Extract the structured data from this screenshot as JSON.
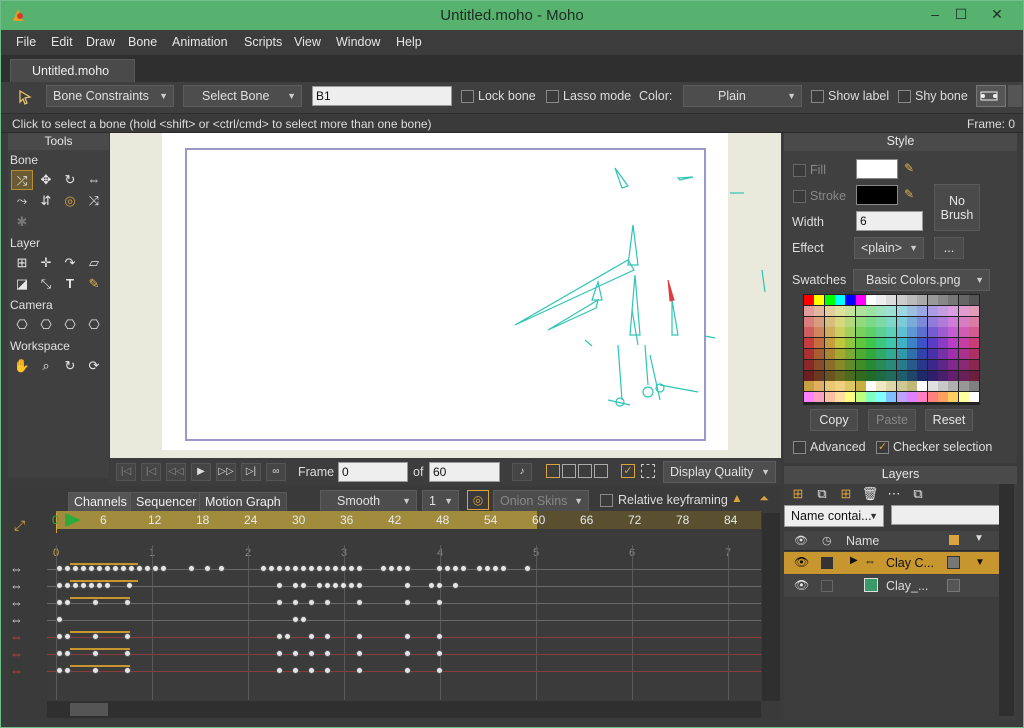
{
  "window": {
    "title": "Untitled.moho - Moho",
    "min": "–",
    "max": "☐",
    "close": "✕"
  },
  "menu": [
    "File",
    "Edit",
    "Draw",
    "Bone",
    "Animation",
    "Scripts",
    "View",
    "Window",
    "Help"
  ],
  "doc_tab": "Untitled.moho",
  "toolbar": {
    "bone_constraints": "Bone Constraints",
    "select_bone": "Select Bone",
    "bone_name": "B1",
    "lock_bone": "Lock bone",
    "lasso_mode": "Lasso mode",
    "color_label": "Color:",
    "color_value": "Plain",
    "show_label": "Show label",
    "shy_bone": "Shy bone"
  },
  "status": {
    "hint": "Click to select a bone (hold <shift> or <ctrl/cmd> to select more than one bone)",
    "frame": "Frame: 0"
  },
  "tools": {
    "title": "Tools",
    "bone": "Bone",
    "layer": "Layer",
    "camera": "Camera",
    "workspace": "Workspace"
  },
  "playback": {
    "frame_label": "Frame",
    "frame_value": "0",
    "of_label": "of",
    "total_value": "60",
    "display_quality": "Display Quality"
  },
  "timeline": {
    "tabs": [
      "Channels",
      "Sequencer",
      "Motion Graph"
    ],
    "interp": "Smooth",
    "interp_num": "1",
    "onion": "Onion Skins",
    "relative": "Relative keyframing",
    "ruler": [
      "0",
      "6",
      "12",
      "18",
      "24",
      "30",
      "36",
      "42",
      "48",
      "54",
      "60",
      "66",
      "72",
      "78",
      "84"
    ],
    "seconds": [
      "0",
      "1",
      "2",
      "3",
      "4",
      "5",
      "6",
      "7"
    ]
  },
  "style": {
    "title": "Style",
    "fill": "Fill",
    "stroke": "Stroke",
    "width_label": "Width",
    "width_value": "6",
    "no_brush": "No Brush",
    "effect_label": "Effect",
    "effect_value": "<plain>",
    "effect_btn": "...",
    "swatches_label": "Swatches",
    "swatches_value": "Basic Colors.png",
    "copy": "Copy",
    "paste": "Paste",
    "reset": "Reset",
    "advanced": "Advanced",
    "checker": "Checker selection"
  },
  "layers": {
    "title": "Layers",
    "filter": "Name contai...",
    "name_header": "Name",
    "items": [
      {
        "name": "Clay C...",
        "selected": true
      },
      {
        "name": "Clay_...",
        "selected": false
      }
    ]
  },
  "colors": {
    "accent": "#c8962e",
    "titlebar": "#57b26f",
    "bone": "#2ec4b6",
    "selected_bone": "#e23b3b"
  }
}
